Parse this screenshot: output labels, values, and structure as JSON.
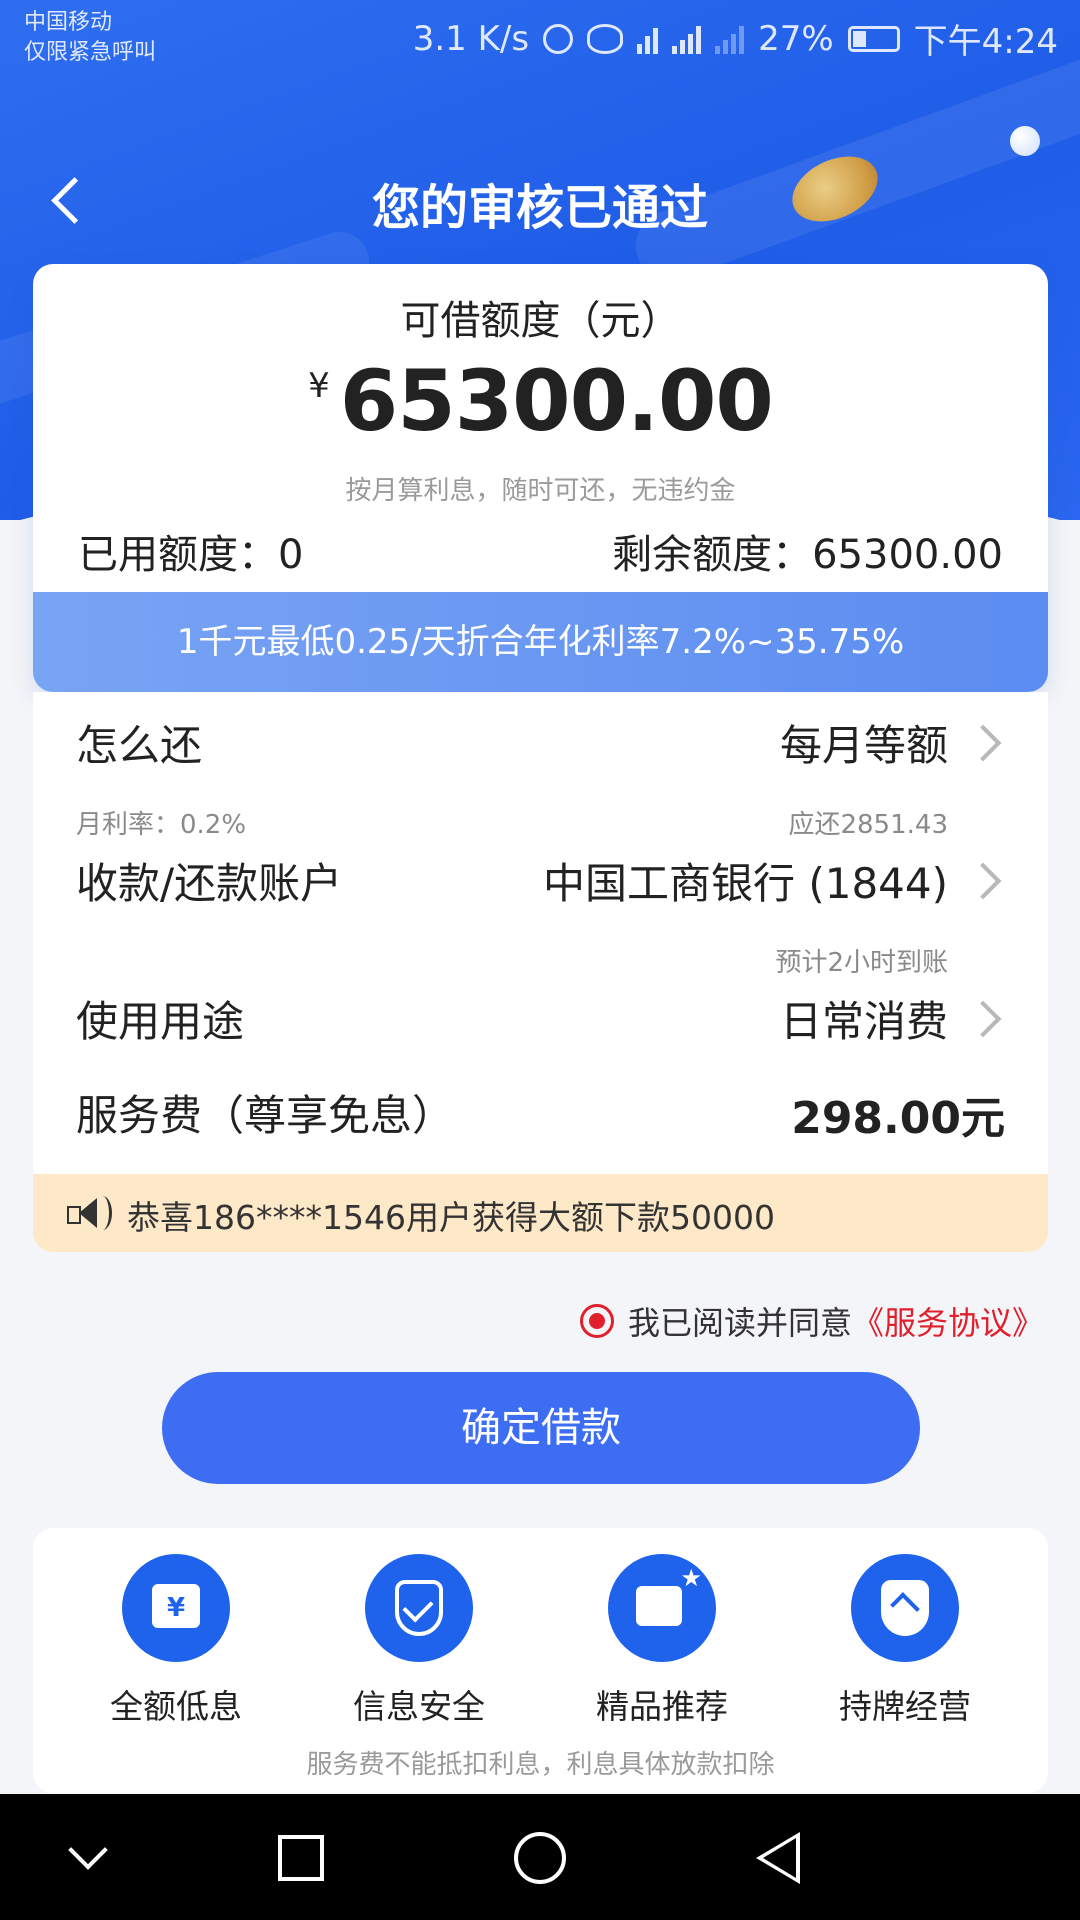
{
  "status_bar": {
    "carrier_line1": "中国移动",
    "carrier_line2": "仅限紧急呼叫",
    "speed": "3.1 K/s",
    "network": "4G",
    "battery": "27%",
    "time": "下午4:24"
  },
  "header": {
    "title": "您的审核已通过"
  },
  "limit_card": {
    "label": "可借额度（元）",
    "currency": "¥",
    "amount": "65300.00",
    "subtitle": "按月算利息，随时可还，无违约金",
    "used_label": "已用额度：0",
    "remaining_label": "剩余额度：65300.00",
    "rate_banner": "1千元最低0.25/天折合年化利率7.2%~35.75%"
  },
  "details": {
    "repay": {
      "label": "怎么还",
      "value": "每月等额",
      "sub_left": "月利率：0.2%",
      "sub_right": "应还2851.43"
    },
    "account": {
      "label": "收款/还款账户",
      "value": "中国工商银行 (1844)",
      "sub_right": "预计2小时到账"
    },
    "purpose": {
      "label": "使用用途",
      "value": "日常消费"
    },
    "fee": {
      "label": "服务费（尊享免息）",
      "value": "298.00元"
    }
  },
  "notice": {
    "text": "恭喜186****1546用户获得大额下款50000"
  },
  "agreement": {
    "text": "我已阅读并同意",
    "link": "《服务协议》"
  },
  "confirm_button": "确定借款",
  "features": {
    "items": [
      {
        "label": "全额低息",
        "icon": "calendar-yen-icon"
      },
      {
        "label": "信息安全",
        "icon": "shield-check-icon"
      },
      {
        "label": "精品推荐",
        "icon": "thumbs-up-icon"
      },
      {
        "label": "持牌经营",
        "icon": "licensed-shield-icon"
      }
    ],
    "note": "服务费不能抵扣利息，利息具体放款扣除"
  },
  "colors": {
    "primary": "#1f63ec",
    "button": "#3d6df2",
    "accent_red": "#e0202c",
    "notice_bg": "#fde8c8"
  }
}
